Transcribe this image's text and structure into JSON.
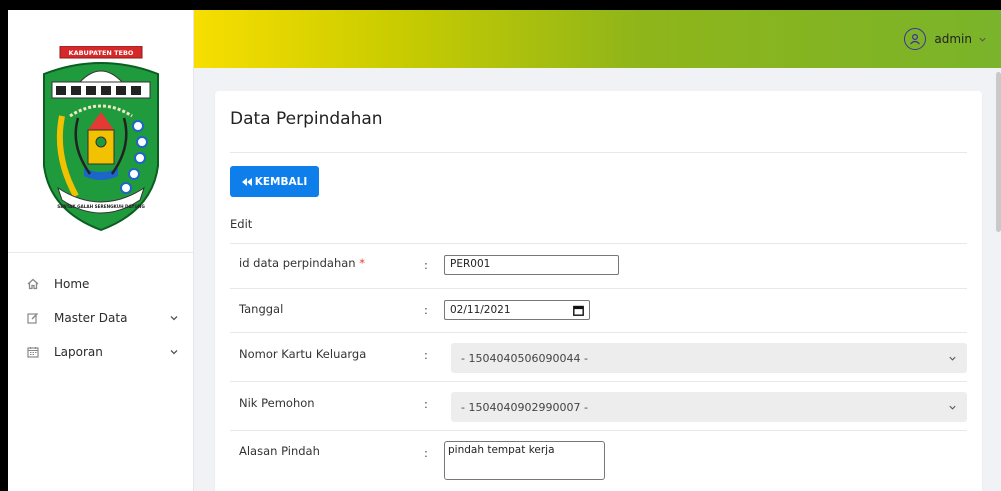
{
  "header": {
    "user_name": "admin"
  },
  "sidebar": {
    "logo_text_top": "KABUPATEN TEBO",
    "logo_text_bottom": "SENTAK GALAH SERENGKUH DAYUNG",
    "items": [
      {
        "label": "Home",
        "icon": "home-icon",
        "has_children": false
      },
      {
        "label": "Master Data",
        "icon": "edit-icon",
        "has_children": true
      },
      {
        "label": "Laporan",
        "icon": "calendar-icon",
        "has_children": true
      }
    ]
  },
  "card": {
    "title": "Data Perpindahan",
    "back_button_label": "KEMBALI",
    "section_label": "Edit"
  },
  "form": {
    "colon": ":",
    "required_mark": "*",
    "id_label": "id data perpindahan",
    "id_value": "PER001",
    "tanggal_label": "Tanggal",
    "tanggal_value": "02/11/2021",
    "kk_label": "Nomor Kartu Keluarga",
    "kk_value": "- 1504040506090044 -",
    "nik_label": "Nik Pemohon",
    "nik_value": "- 1504040902990007 -",
    "alasan_label": "Alasan Pindah",
    "alasan_value": "pindah tempat kerja"
  },
  "colors": {
    "primary_button": "#0d7eea",
    "topbar_start": "#f7de00",
    "topbar_end": "#7ab42a",
    "required": "#e53935"
  }
}
